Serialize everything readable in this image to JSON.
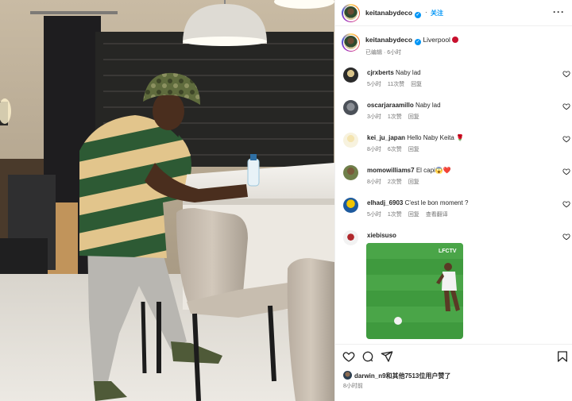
{
  "post": {
    "author": "keitanabydeco",
    "follow_separator": "·",
    "follow_label": "关注",
    "more_icon": "more-dots-icon",
    "caption_text": "Liverpool",
    "caption_meta": "已编辑 · 6小时",
    "footer_likes_user": "darwin_n9",
    "footer_likes_rest": "和其他7513位用户赞了",
    "footer_time": "8小时前"
  },
  "comments": [
    {
      "user": "cjrxberts",
      "text": "Naby lad",
      "time": "5小时",
      "likes": "11次赞",
      "reply": "回复",
      "translate": ""
    },
    {
      "user": "oscarjaraamillo",
      "text": "Naby lad",
      "time": "3小时",
      "likes": "1次赞",
      "reply": "回复",
      "translate": ""
    },
    {
      "user": "kei_ju_japan",
      "text": "Hello Naby Keita 🌹",
      "time": "8小时",
      "likes": "6次赞",
      "reply": "回复",
      "translate": ""
    },
    {
      "user": "momowilliams7",
      "text": "El capi😱❤️",
      "time": "8小时",
      "likes": "2次赞",
      "reply": "回复",
      "translate": ""
    },
    {
      "user": "elhadj_6903",
      "text": "C'est le bon moment ?",
      "time": "5小时",
      "likes": "1次赞",
      "reply": "回复",
      "translate": "查看翻译"
    },
    {
      "user": "xiebisuso",
      "text": "",
      "time": "",
      "likes": "",
      "reply": "",
      "translate": ""
    }
  ],
  "media": {
    "watermark": "LFCTV"
  },
  "colors": {
    "accent": "#0095f6",
    "muted": "#737373",
    "liverpool_red": "#c8102e"
  },
  "icons": [
    "heart-icon",
    "comment-icon",
    "share-icon",
    "bookmark-icon"
  ]
}
